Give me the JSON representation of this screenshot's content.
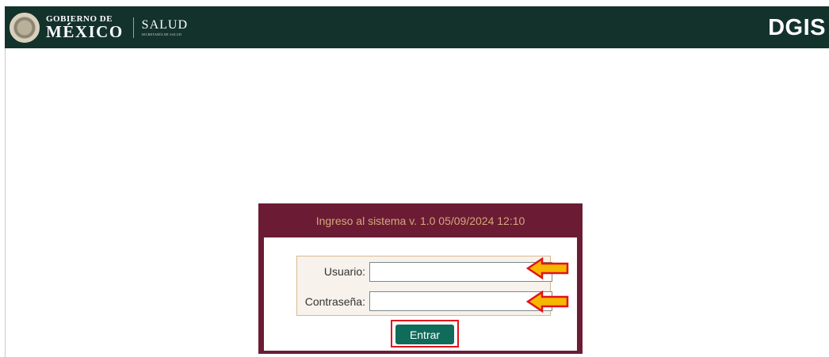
{
  "header": {
    "gob_line1": "GOBIERNO DE",
    "gob_line2": "MÉXICO",
    "salud_title": "SALUD",
    "salud_subtitle": "SECRETARÍA DE SALUD",
    "brand": "DGIS",
    "colors": {
      "background": "#13322b",
      "text": "#ffffff"
    }
  },
  "login": {
    "title": "Ingreso al sistema v. 1.0 05/09/2024 12:10",
    "username_label": "Usuario:",
    "username_value": "",
    "password_label": "Contraseña:",
    "password_value": "",
    "submit_label": "Entrar",
    "colors": {
      "panel": "#6b1c34",
      "title": "#d3a87a",
      "button": "#0f6b5a",
      "highlight": "#e3121b",
      "arrow": "#f5b700"
    }
  },
  "annotations": {
    "arrow_icon": "arrow-left-icon",
    "arrow_count": 2
  }
}
